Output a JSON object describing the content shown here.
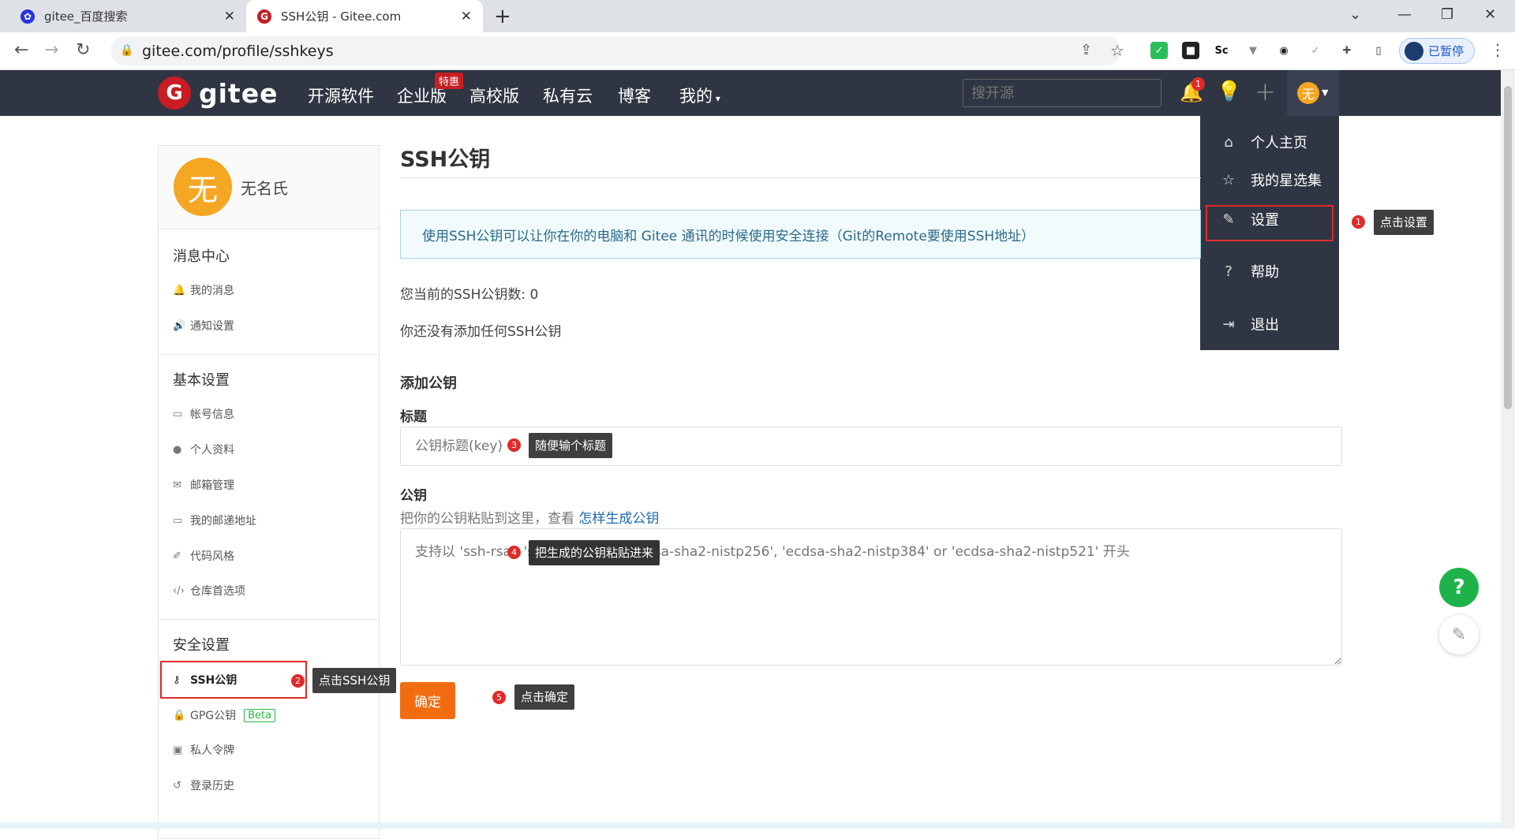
{
  "browser": {
    "tabs": [
      {
        "title": "gitee_百度搜索",
        "icon": "baidu-paw-icon"
      },
      {
        "title": "SSH公钥 - Gitee.com",
        "icon": "gitee-logo-icon"
      }
    ],
    "url": "gitee.com/profile/sshkeys",
    "profile_status": "已暂停",
    "extensions": [
      "shield-ext-icon",
      "dark-ext-icon",
      "sc-ext-icon",
      "vue-ext-icon",
      "ext-icon",
      "check-ext-icon",
      "puzzle-icon"
    ]
  },
  "header": {
    "logo_text": "gitee",
    "nav": [
      "开源软件",
      "企业版",
      "高校版",
      "私有云",
      "博客",
      "我的"
    ],
    "promo_badge": "特惠",
    "search_placeholder": "搜开源",
    "notification_count": "1",
    "avatar_text": "无"
  },
  "dropdown": {
    "items": [
      {
        "label": "个人主页",
        "icon": "home-icon"
      },
      {
        "label": "我的星选集",
        "icon": "star-icon"
      },
      {
        "label": "设置",
        "icon": "edit-icon"
      },
      {
        "label": "帮助",
        "icon": "help-circle-icon"
      },
      {
        "label": "退出",
        "icon": "logout-icon"
      }
    ]
  },
  "sidebar": {
    "avatar_text": "无",
    "username": "无名氏",
    "sections": [
      {
        "title": "消息中心",
        "items": [
          {
            "label": "我的消息",
            "icon": "bell-icon"
          },
          {
            "label": "通知设置",
            "icon": "speaker-icon"
          }
        ]
      },
      {
        "title": "基本设置",
        "items": [
          {
            "label": "帐号信息",
            "icon": "id-card-icon"
          },
          {
            "label": "个人资料",
            "icon": "user-icon"
          },
          {
            "label": "邮箱管理",
            "icon": "mail-icon"
          },
          {
            "label": "我的邮递地址",
            "icon": "address-card-icon"
          },
          {
            "label": "代码风格",
            "icon": "brush-icon"
          },
          {
            "label": "仓库首选项",
            "icon": "code-icon"
          }
        ]
      },
      {
        "title": "安全设置",
        "items": [
          {
            "label": "SSH公钥",
            "icon": "key-icon",
            "active": true
          },
          {
            "label": "GPG公钥",
            "icon": "lock-icon",
            "badge": "Beta"
          },
          {
            "label": "私人令牌",
            "icon": "token-icon"
          },
          {
            "label": "登录历史",
            "icon": "history-icon"
          }
        ]
      }
    ]
  },
  "main": {
    "title": "SSH公钥",
    "info": "使用SSH公钥可以让你在你的电脑和 Gitee 通讯的时候使用安全连接（Git的Remote要使用SSH地址）",
    "count_text": "您当前的SSH公钥数: 0",
    "empty_text": "你还没有添加任何SSH公钥",
    "add_heading": "添加公钥",
    "title_label": "标题",
    "title_placeholder": "公钥标题(key)",
    "key_label": "公钥",
    "key_hint_prefix": "把你的公钥粘贴到这里，查看",
    "key_hint_link": "怎样生成公钥",
    "key_placeholder": "支持以 'ssh-rsa', 'ssh-ed25519', 'ecdsa-sha2-nistp256', 'ecdsa-sha2-nistp384' or 'ecdsa-sha2-nistp521' 开头",
    "submit_label": "确定"
  },
  "annotations": [
    {
      "num": "1",
      "text": "点击设置"
    },
    {
      "num": "2",
      "text": "点击SSH公钥"
    },
    {
      "num": "3",
      "text": "随便输个标题"
    },
    {
      "num": "4",
      "text": "把生成的公钥粘贴进来"
    },
    {
      "num": "5",
      "text": "点击确定"
    }
  ],
  "colors": {
    "header_bg": "#2f3542",
    "brand_red": "#c71d23",
    "submit_orange": "#f36c10",
    "annotation_red": "#e02a2a",
    "help_green": "#1db34a"
  }
}
